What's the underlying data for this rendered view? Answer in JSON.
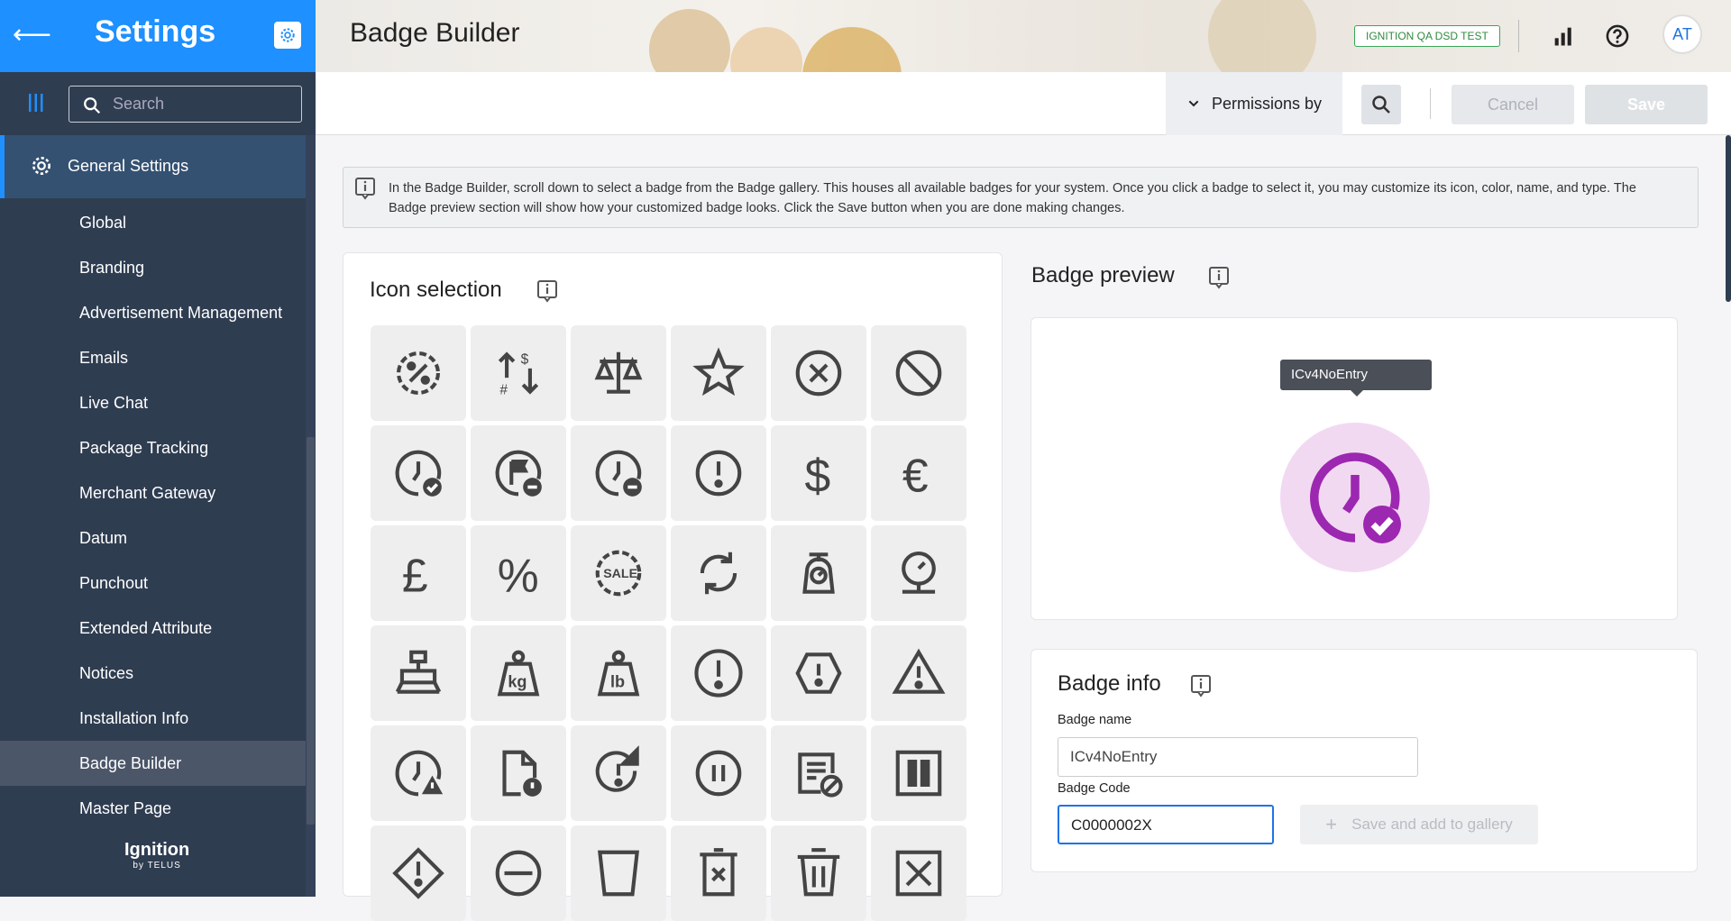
{
  "sidebar": {
    "title": "Settings",
    "search_placeholder": "Search",
    "section": "General Settings",
    "items": [
      {
        "label": "Global"
      },
      {
        "label": "Branding"
      },
      {
        "label": "Advertisement Management"
      },
      {
        "label": "Emails"
      },
      {
        "label": "Live Chat"
      },
      {
        "label": "Package Tracking"
      },
      {
        "label": "Merchant Gateway"
      },
      {
        "label": "Datum"
      },
      {
        "label": "Punchout"
      },
      {
        "label": "Extended Attribute"
      },
      {
        "label": "Notices"
      },
      {
        "label": "Installation Info"
      },
      {
        "label": "Badge Builder",
        "active": true
      },
      {
        "label": "Master Page"
      }
    ],
    "logo_text": "Ignition",
    "logo_sub": "by TELUS"
  },
  "header": {
    "title": "Badge Builder",
    "env_badge": "IGNITION QA DSD TEST",
    "avatar_initials": "AT"
  },
  "toolbar": {
    "permissions_label": "Permissions by",
    "cancel_label": "Cancel",
    "save_label": "Save"
  },
  "info_banner": "In the Badge Builder, scroll down to select a badge from the Badge gallery. This houses all available badges for your system. Once you click a badge to select it, you may customize its icon, color, name, and type. The Badge preview section will show how your customized badge looks. Click the Save button when you are done making changes.",
  "icon_selection": {
    "title": "Icon selection",
    "icons": [
      "percent-badge-icon",
      "sort-dollar-icon",
      "scale-balance-icon",
      "star-icon",
      "close-circle-icon",
      "block-icon",
      "clock-check-icon",
      "flag-minus-icon",
      "clock-minus-icon",
      "alert-circle-icon",
      "dollar-icon",
      "euro-icon",
      "pound-icon",
      "percent-icon",
      "sale-icon",
      "refresh-icon",
      "kitchen-scale-icon",
      "weight-scale-icon",
      "stamp-icon",
      "kg-weight-icon",
      "lb-weight-icon",
      "alert-circle-large-icon",
      "alert-octagon-icon",
      "alert-triangle-icon",
      "clock-alert-icon",
      "file-alert-icon",
      "restart-alert-icon",
      "pause-circle-icon",
      "note-cancel-icon",
      "pause-box-icon",
      "alert-diamond-icon",
      "minus-circle-icon",
      "cup-icon",
      "delete-box-icon",
      "trash-icon",
      "close-box-icon"
    ]
  },
  "badge_preview": {
    "title": "Badge preview",
    "tooltip": "ICv4NoEntry",
    "icon_color": "#9c27b0",
    "bg_color": "#f2d9f2"
  },
  "badge_info": {
    "title": "Badge info",
    "name_label": "Badge name",
    "name_value": "ICv4NoEntry",
    "code_label": "Badge Code",
    "code_value": "C0000002X",
    "add_button": "Save and add to gallery"
  }
}
